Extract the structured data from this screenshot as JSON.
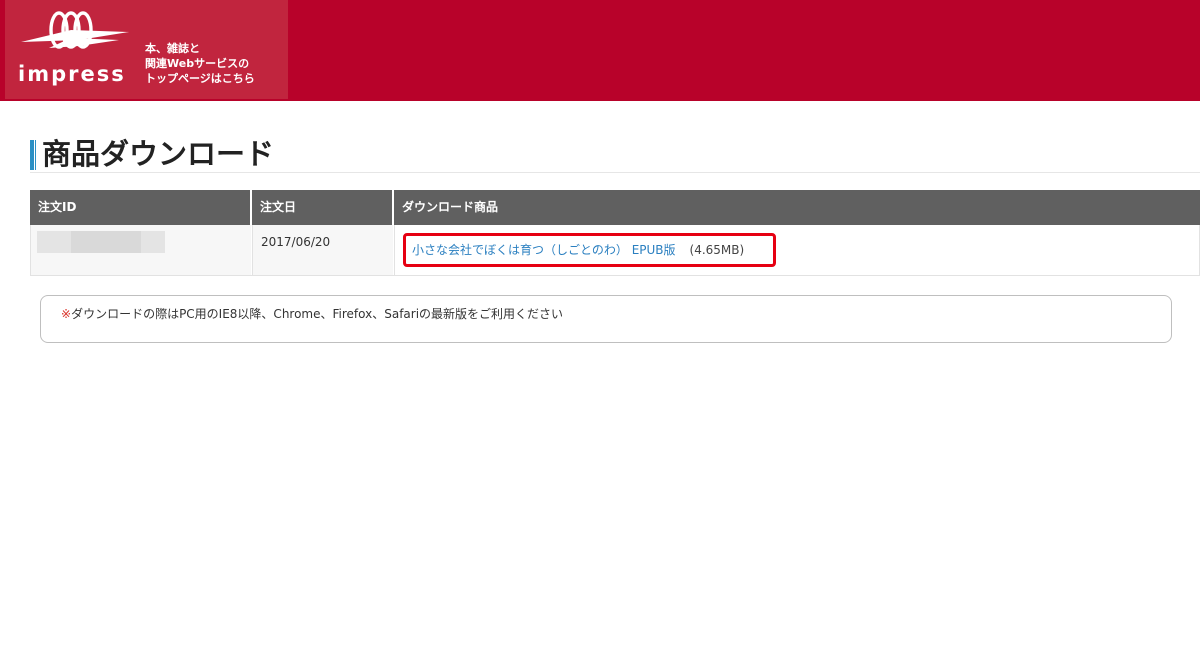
{
  "header": {
    "logo_text": "impress",
    "tagline_lines": [
      "本、雑誌と",
      "関連Webサービスの",
      "トップページはこちら"
    ],
    "colors": {
      "header_bg": "#b8022a",
      "logo_box_bg": "#c1253e"
    }
  },
  "page": {
    "title": "商品ダウンロード",
    "accent_color": "#2b8fc4"
  },
  "table": {
    "columns": [
      "注文ID",
      "注文日",
      "ダウンロード商品"
    ],
    "rows": [
      {
        "order_id": "",
        "order_date": "2017/06/20",
        "product_title": "小さな会社でぼくは育つ（しごとのわ） EPUB版",
        "file_size": "(4.65MB)"
      }
    ]
  },
  "notice": {
    "mark": "※",
    "text": "ダウンロードの際はPC用のIE8以降、Chrome、Firefox、Safariの最新版をご利用ください"
  },
  "colors": {
    "link": "#2a7fc0",
    "highlight_border": "#e60012",
    "table_header_bg": "#606060"
  }
}
